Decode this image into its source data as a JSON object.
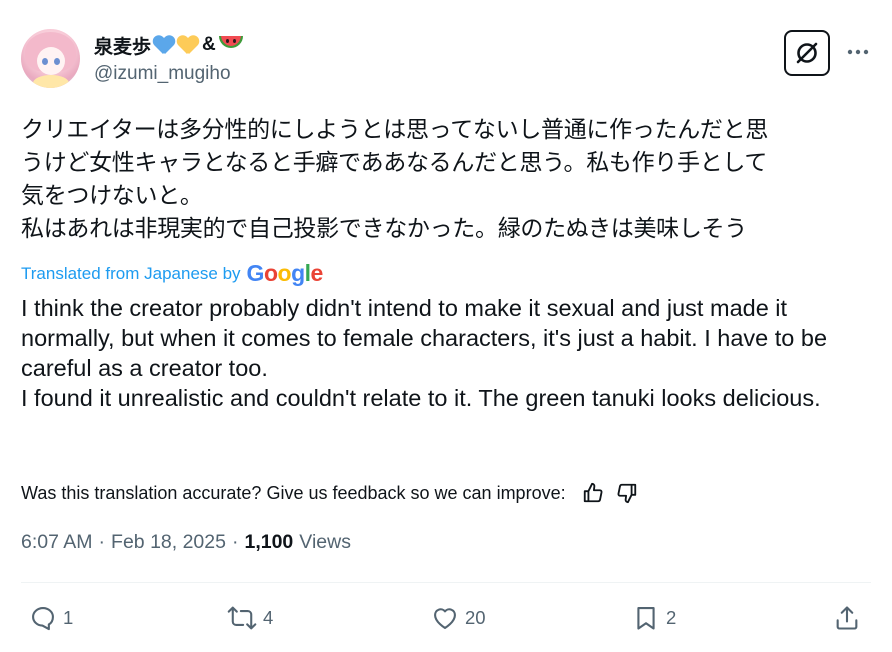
{
  "user": {
    "display_name": "泉麦歩",
    "amp": "&",
    "handle": "@izumi_mugiho",
    "emoji": [
      "blue-heart",
      "yellow-heart",
      "watermelon"
    ]
  },
  "post": {
    "original_lines": [
      "クリエイターは多分性的にしようとは思ってないし普通に作ったんだと思",
      "うけど女性キャラとなると手癖でああなるんだと思う。私も作り手として",
      "気をつけないと。",
      "私はあれは非現実的で自己投影できなかった。緑のたぬきは美味しそう"
    ],
    "translated_from_label": "Translated from Japanese by",
    "google_letters": [
      "G",
      "o",
      "o",
      "g",
      "l",
      "e"
    ],
    "translation_lines": [
      "I think the creator probably didn't intend to make it sexual and just made it normally, but when it comes to female characters, it's just a habit. I have to be careful as a creator too.",
      "I found it unrealistic and couldn't relate to it. The green tanuki looks delicious."
    ],
    "feedback_prompt": "Was this translation accurate? Give us feedback so we can improve:",
    "time": "6:07 AM",
    "date": "Feb 18, 2025",
    "views_count": "1,100",
    "views_label": "Views",
    "separator": "·"
  },
  "actions": {
    "replies": "1",
    "reposts": "4",
    "likes": "20",
    "bookmarks": "2"
  },
  "colors": {
    "text": "#0f1419",
    "muted": "#536471",
    "link": "#1d9bf0",
    "divider": "#eff3f4",
    "blue_heart": "#5ba7ea",
    "yellow_heart": "#fdcb58"
  }
}
